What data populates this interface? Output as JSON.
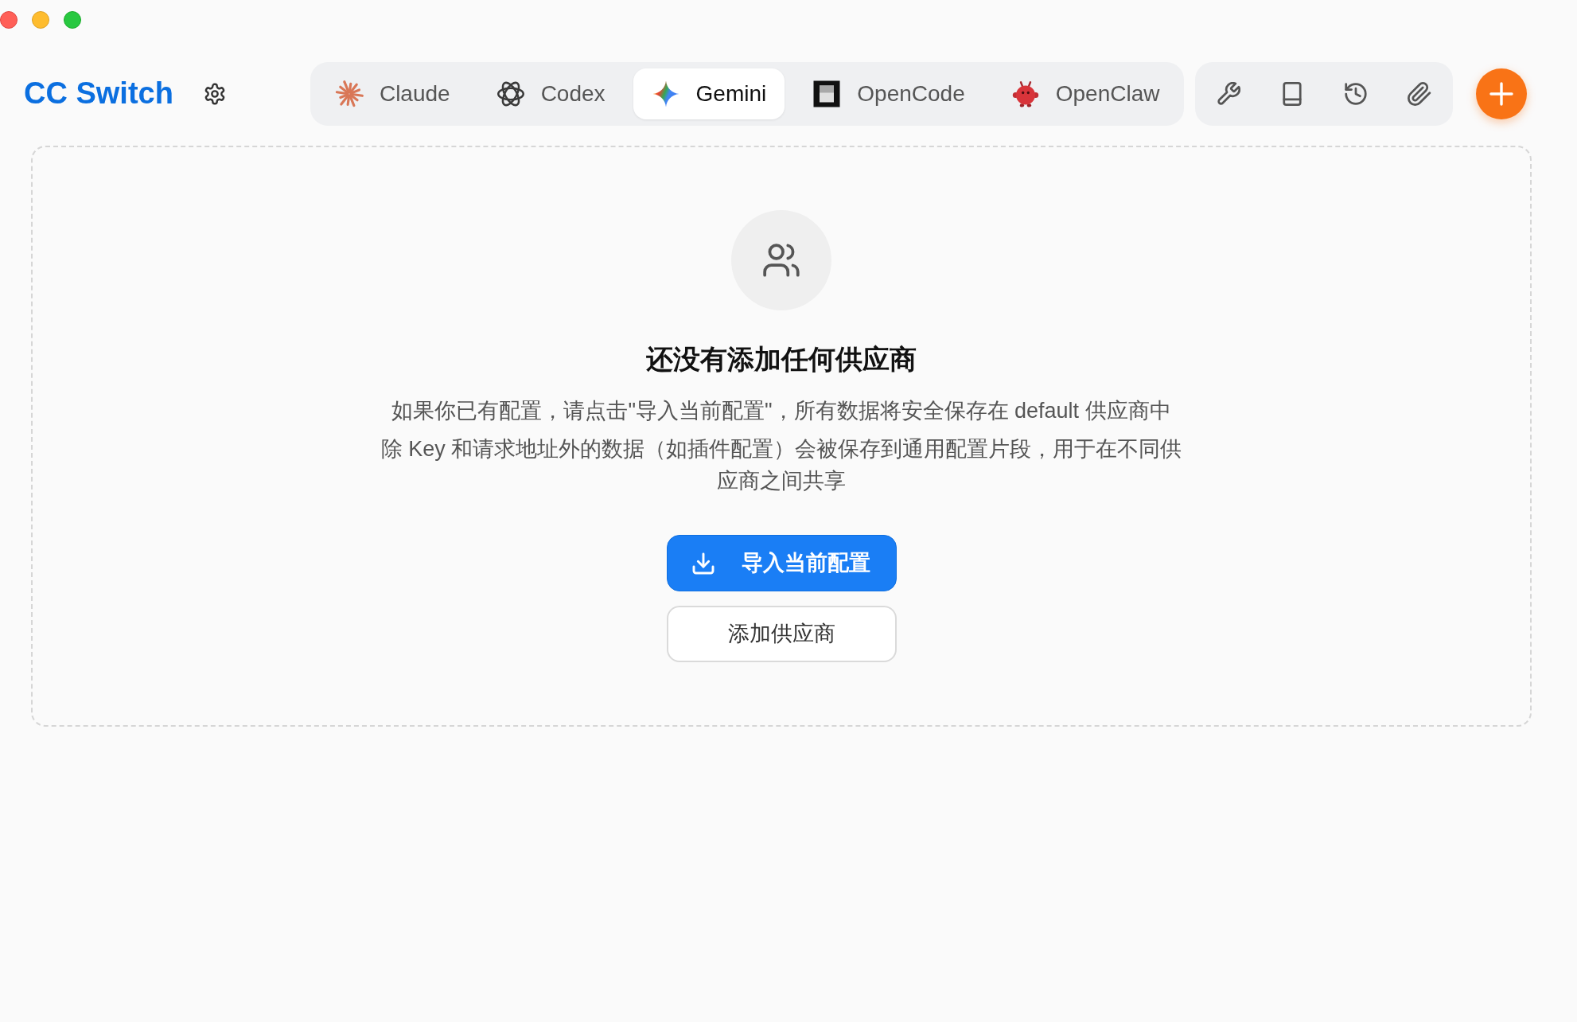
{
  "app": {
    "title": "CC Switch"
  },
  "tabs": [
    {
      "label": "Claude",
      "selected": false
    },
    {
      "label": "Codex",
      "selected": false
    },
    {
      "label": "Gemini",
      "selected": true
    },
    {
      "label": "OpenCode",
      "selected": false
    },
    {
      "label": "OpenClaw",
      "selected": false
    }
  ],
  "empty_state": {
    "title": "还没有添加任何供应商",
    "paragraphs": [
      "如果你已有配置，请点击\"导入当前配置\"，所有数据将安全保存在 default 供应商中",
      "除 Key 和请求地址外的数据（如插件配置）会被保存到通用配置片段，用于在不同供应商之间共享"
    ],
    "buttons": [
      {
        "label": "导入当前配置",
        "kind": "primary"
      },
      {
        "label": "添加供应商",
        "kind": "secondary"
      }
    ]
  }
}
